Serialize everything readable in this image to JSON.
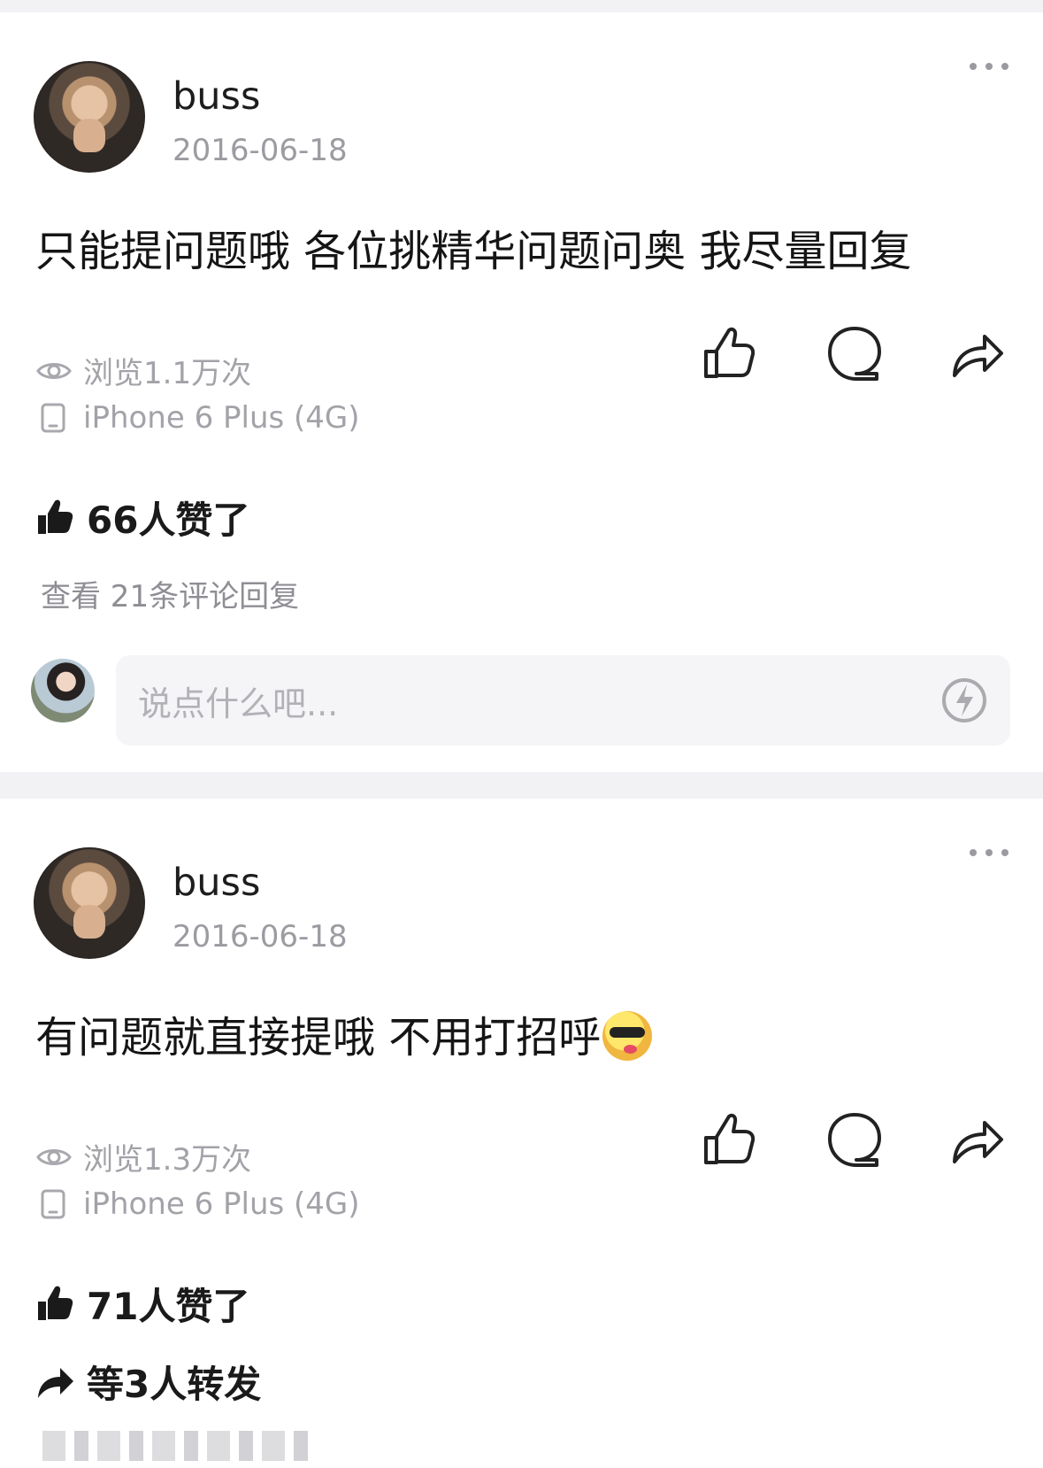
{
  "posts": [
    {
      "username": "buss",
      "date": "2016-06-18",
      "content": "只能提问题哦 各位挑精华问题问奥 我尽量回复",
      "views": "浏览1.1万次",
      "device": "iPhone 6 Plus (4G)",
      "likes_text": "66人赞了",
      "comments_link": "查看 21条评论回复",
      "comment_placeholder": "说点什么吧..."
    },
    {
      "username": "buss",
      "date": "2016-06-18",
      "content": "有问题就直接提哦 不用打招呼",
      "emoji": "sunglasses-tongue-face",
      "views": "浏览1.3万次",
      "device": "iPhone 6 Plus (4G)",
      "likes_text": "71人赞了",
      "repost_text": "等3人转发"
    }
  ],
  "icons": {
    "more": "more-dots-icon",
    "view": "eye-icon",
    "device": "phone-icon",
    "like": "thumb-up-icon",
    "comment": "comment-bubble-icon",
    "share": "share-arrow-icon",
    "lightning": "lightning-icon"
  },
  "colors": {
    "background": "#ffffff",
    "separator": "#f2f2f4",
    "primary_text": "#111111",
    "secondary_text": "#9b9ba1",
    "input_background": "#f5f5f7"
  }
}
